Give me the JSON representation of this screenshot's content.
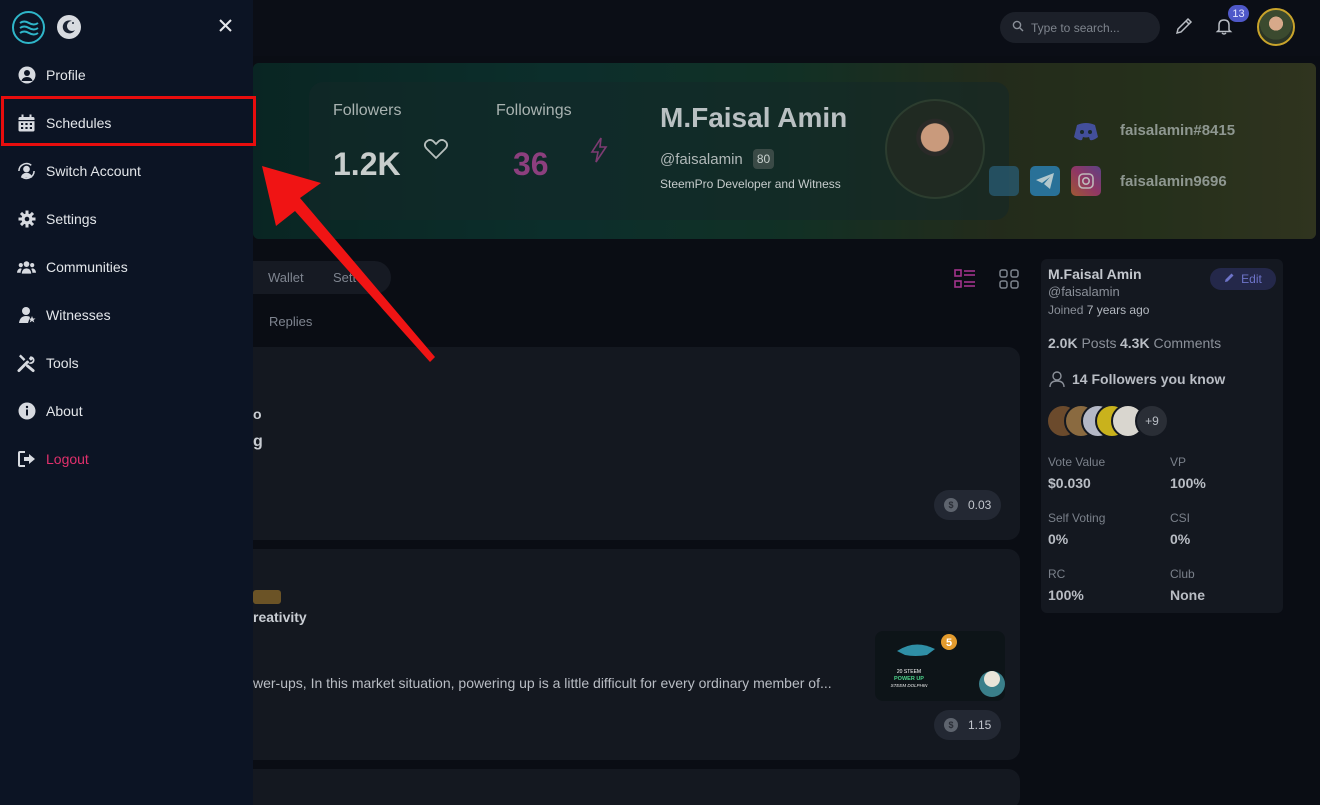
{
  "topbar": {
    "search_placeholder": "Type to search...",
    "notification_count": "13"
  },
  "drawer": {
    "items": [
      {
        "label": "Profile",
        "icon": "user-circle-icon"
      },
      {
        "label": "Schedules",
        "icon": "calendar-icon"
      },
      {
        "label": "Switch Account",
        "icon": "switch-account-icon"
      },
      {
        "label": "Settings",
        "icon": "gear-icon"
      },
      {
        "label": "Communities",
        "icon": "users-icon"
      },
      {
        "label": "Witnesses",
        "icon": "witness-icon"
      },
      {
        "label": "Tools",
        "icon": "tools-icon"
      },
      {
        "label": "About",
        "icon": "info-icon"
      },
      {
        "label": "Logout",
        "icon": "logout-icon"
      }
    ],
    "highlighted_item": "Schedules",
    "colors": {
      "logout": "#e1306c",
      "highlight_box": "#e80d0d",
      "arrow": "#f01414"
    }
  },
  "cover": {
    "followers_label": "Followers",
    "followers_value": "1.2K",
    "followings_label": "Followings",
    "followings_value": "36",
    "name": "M.Faisal Amin",
    "handle": "@faisalamin",
    "reputation": "80",
    "tagline": "SteemPro Developer and Witness",
    "discord": "faisalamin#8415",
    "instagram": "faisalamin9696"
  },
  "tabs": {
    "wallet": "Wallet",
    "settings_partial": "Sett",
    "replies": "Replies"
  },
  "posts": [
    {
      "line1": "o",
      "line2": "g",
      "payout": "0.03"
    },
    {
      "title": "reativity",
      "excerpt": "wer-ups, In this market situation, powering up is a little difficult for every ordinary member of...",
      "payout": "1.15",
      "thumb_text_1": "20 STEEM",
      "thumb_text_2": "POWER UP",
      "thumb_text_3": "STEEM DOLPHIN",
      "thumb_num": "5"
    }
  ],
  "side": {
    "name": "M.Faisal Amin",
    "handle": "@faisalamin",
    "joined_prefix": "Joined",
    "joined_value": "7 years ago",
    "edit_label": "Edit",
    "posts_value": "2.0K",
    "posts_label": "Posts",
    "comments_value": "4.3K",
    "comments_label": "Comments",
    "followers_known_count": "14",
    "followers_known_label": "Followers you know",
    "more_avatars": "+9",
    "vote_value_label": "Vote Value",
    "vote_value": "$0.030",
    "vp_label": "VP",
    "vp_value": "100%",
    "self_voting_label": "Self Voting",
    "self_voting_value": "0%",
    "csi_label": "CSI",
    "csi_value": "0%",
    "rc_label": "RC",
    "rc_value": "100%",
    "club_label": "Club",
    "club_value": "None"
  }
}
